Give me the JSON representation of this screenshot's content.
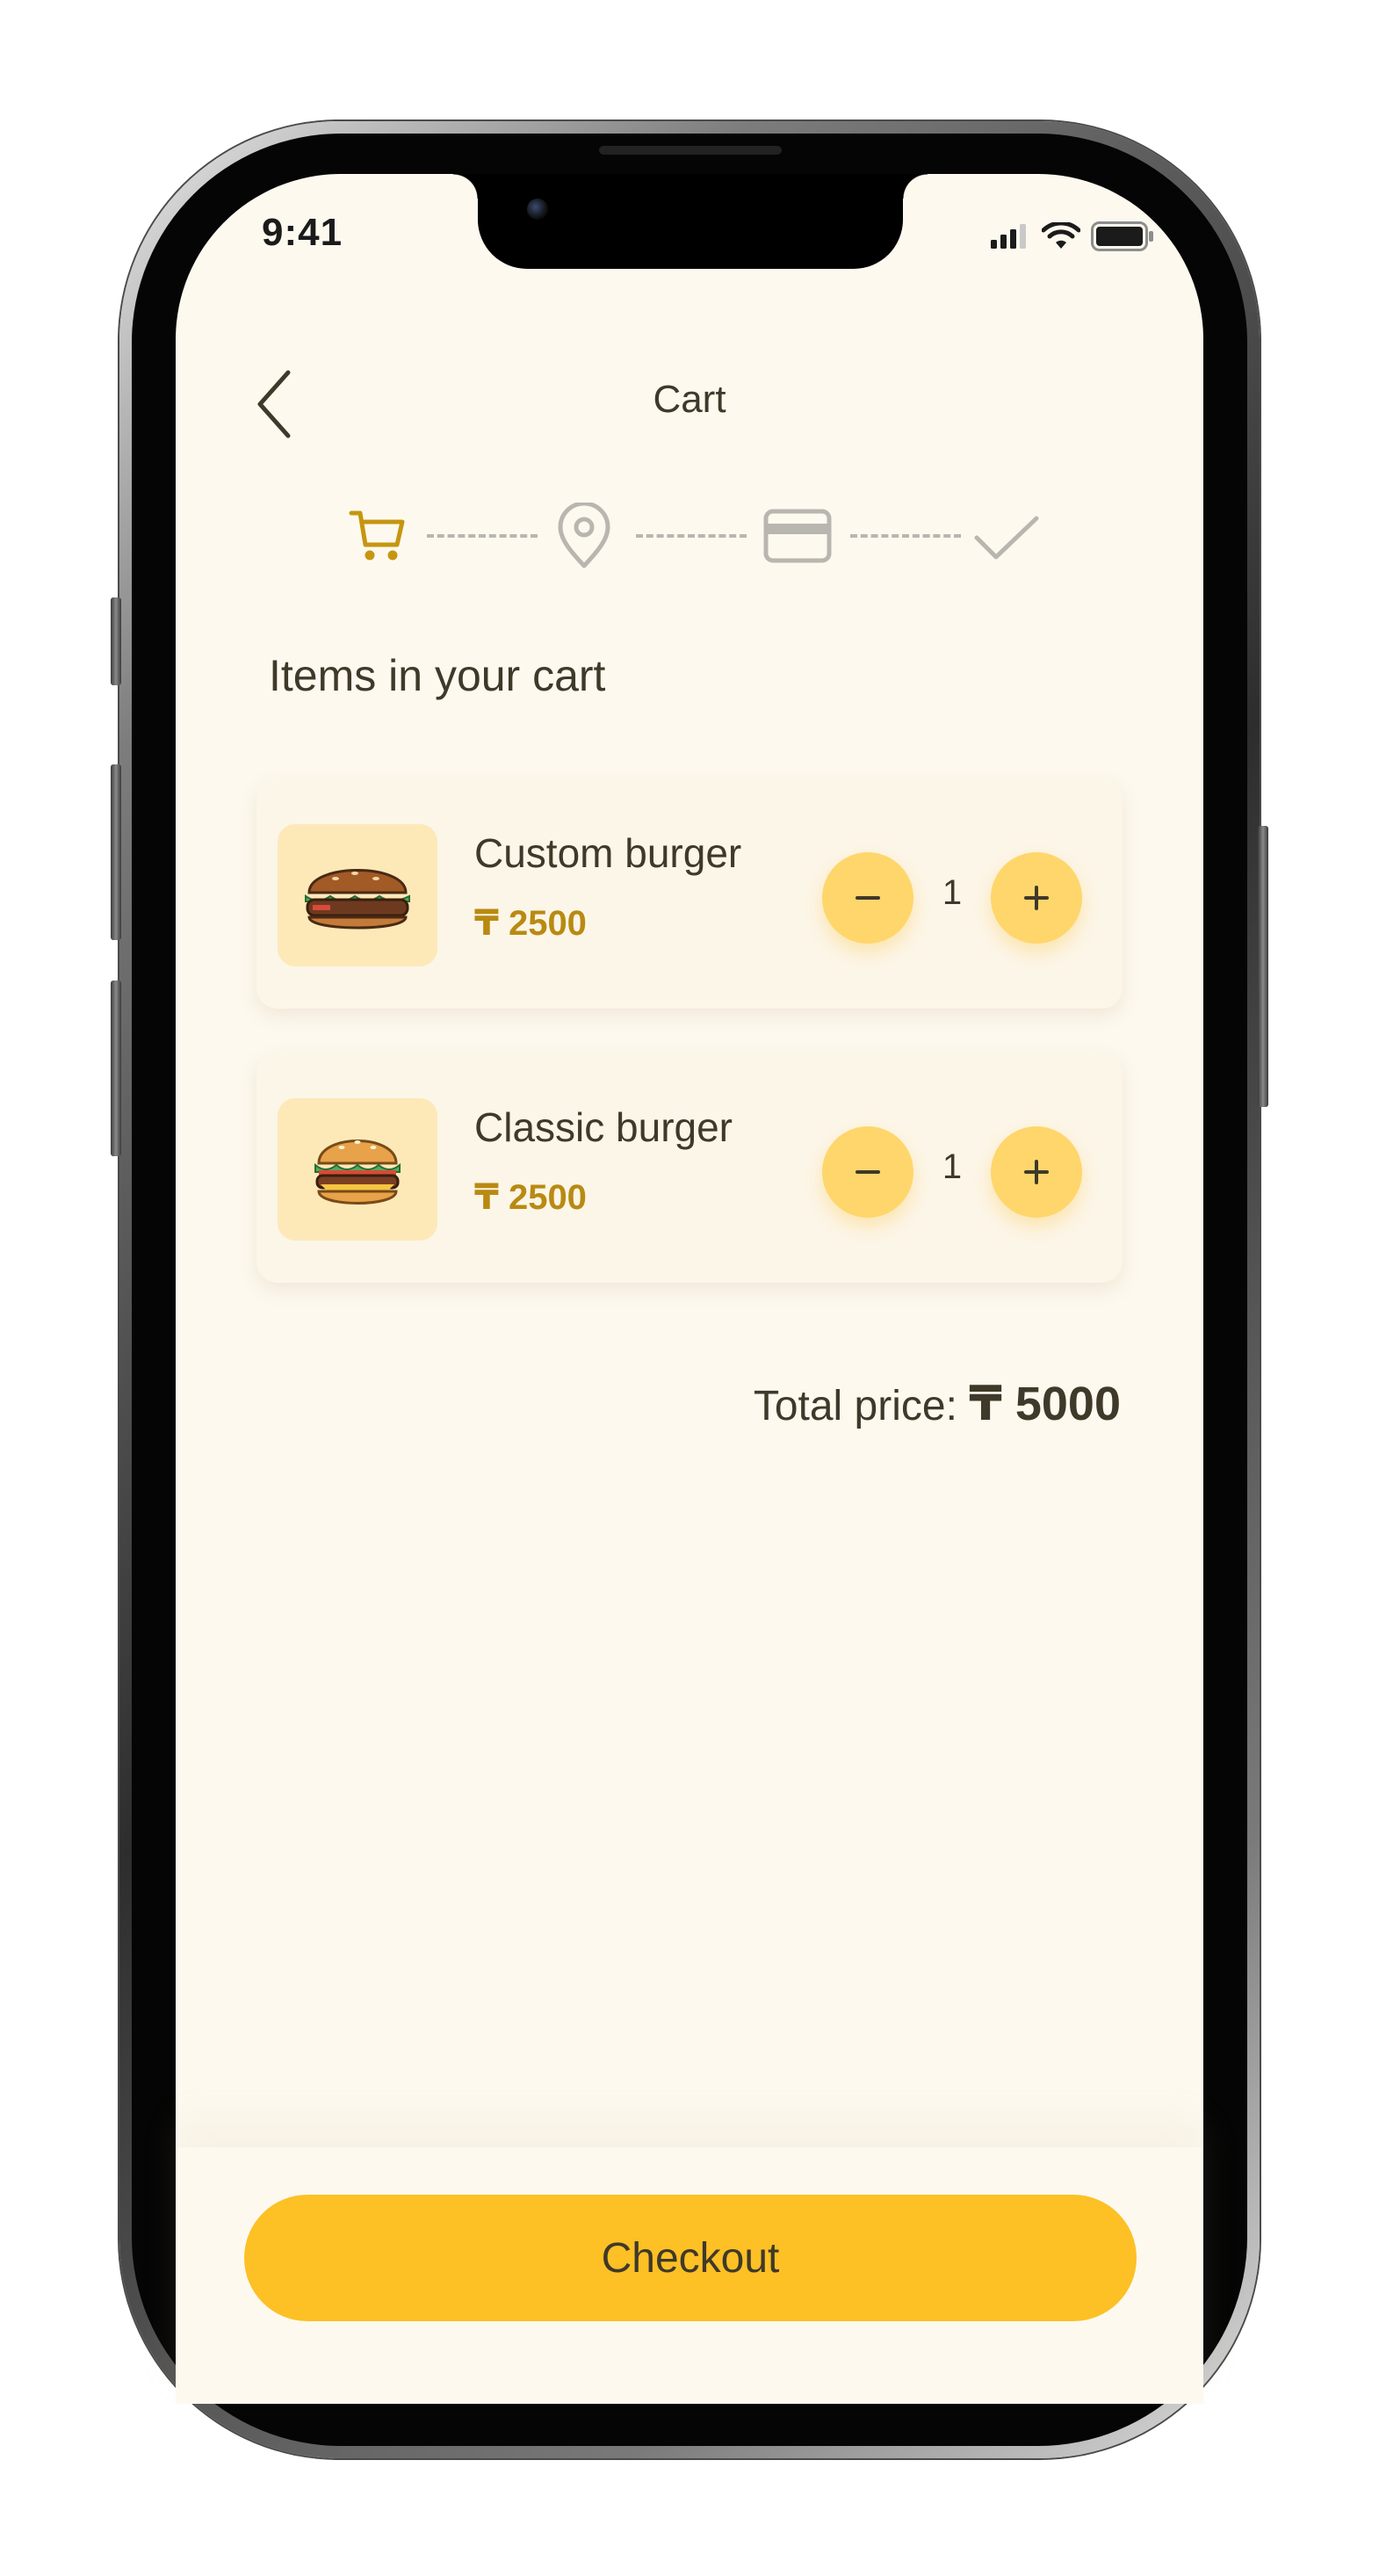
{
  "status_bar": {
    "time": "9:41"
  },
  "header": {
    "title": "Cart",
    "back_icon": "chevron-left-icon"
  },
  "steps": [
    {
      "icon": "cart-icon",
      "state": "active"
    },
    {
      "icon": "location-pin-icon",
      "state": "inactive"
    },
    {
      "icon": "credit-card-icon",
      "state": "inactive"
    },
    {
      "icon": "checkmark-icon",
      "state": "inactive"
    }
  ],
  "cart": {
    "section_title": "Items in your cart",
    "items": [
      {
        "name": "Custom burger",
        "price": "₸ 2500",
        "quantity": "1",
        "image": "burger-icon"
      },
      {
        "name": "Classic burger",
        "price": "₸ 2500",
        "quantity": "1",
        "image": "burger-icon"
      }
    ],
    "total_label": "Total price:",
    "total_value": "₸ 5000"
  },
  "checkout": {
    "label": "Checkout"
  },
  "colors": {
    "background": "#fdf9ef",
    "accent": "#fdc025",
    "accent_light": "#fed66b",
    "price": "#b98a12",
    "text": "#3f3929",
    "muted": "#b9b6b0"
  }
}
